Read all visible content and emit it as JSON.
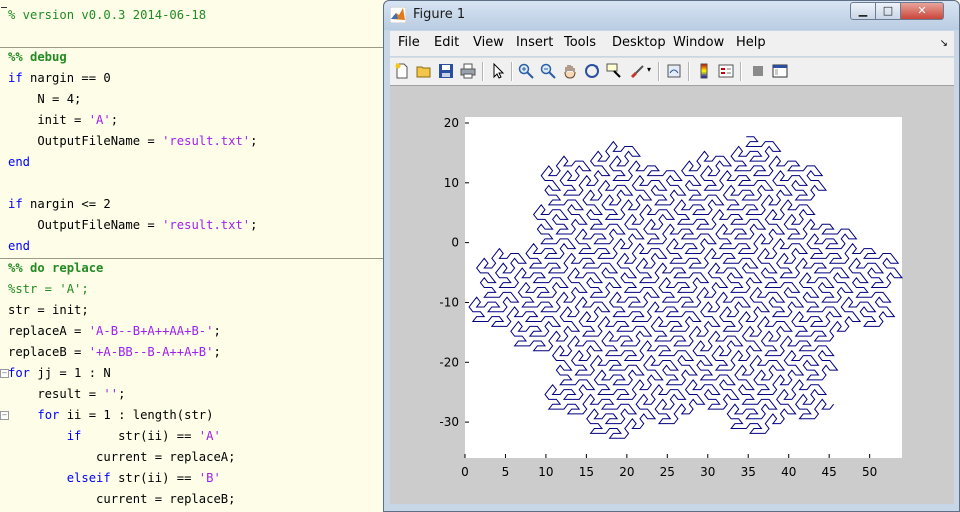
{
  "editor": {
    "lines": [
      {
        "segments": [
          {
            "t": "% version v0.0.3 2014-06-18",
            "c": "comment"
          }
        ]
      },
      {
        "segments": []
      },
      {
        "segments": [
          {
            "t": "%% debug",
            "c": "section"
          }
        ]
      },
      {
        "segments": [
          {
            "t": "if",
            "c": "kw"
          },
          {
            "t": " nargin == 0",
            "c": ""
          }
        ]
      },
      {
        "segments": [
          {
            "t": "    N = 4;",
            "c": ""
          }
        ]
      },
      {
        "segments": [
          {
            "t": "    init = ",
            "c": ""
          },
          {
            "t": "'A'",
            "c": "str"
          },
          {
            "t": ";",
            "c": ""
          }
        ]
      },
      {
        "segments": [
          {
            "t": "    OutputFileName = ",
            "c": ""
          },
          {
            "t": "'result.txt'",
            "c": "str"
          },
          {
            "t": ";",
            "c": ""
          }
        ]
      },
      {
        "segments": [
          {
            "t": "end",
            "c": "kw"
          }
        ]
      },
      {
        "segments": []
      },
      {
        "segments": [
          {
            "t": "if",
            "c": "kw"
          },
          {
            "t": " nargin <= 2",
            "c": ""
          }
        ]
      },
      {
        "segments": [
          {
            "t": "    OutputFileName = ",
            "c": ""
          },
          {
            "t": "'result.txt'",
            "c": "str"
          },
          {
            "t": ";",
            "c": ""
          }
        ]
      },
      {
        "segments": [
          {
            "t": "end",
            "c": "kw"
          }
        ]
      },
      {
        "segments": [
          {
            "t": "%% do replace",
            "c": "section"
          }
        ]
      },
      {
        "segments": [
          {
            "t": "%str = 'A';",
            "c": "comment"
          }
        ]
      },
      {
        "segments": [
          {
            "t": "str = init;",
            "c": ""
          }
        ]
      },
      {
        "segments": [
          {
            "t": "replaceA = ",
            "c": ""
          },
          {
            "t": "'A-B--B+A++AA+B-'",
            "c": "str"
          },
          {
            "t": ";",
            "c": ""
          }
        ]
      },
      {
        "segments": [
          {
            "t": "replaceB = ",
            "c": ""
          },
          {
            "t": "'+A-BB--B-A++A+B'",
            "c": "str"
          },
          {
            "t": ";",
            "c": ""
          }
        ]
      },
      {
        "segments": [
          {
            "t": "for",
            "c": "kw"
          },
          {
            "t": " jj = 1 : N",
            "c": ""
          }
        ]
      },
      {
        "segments": [
          {
            "t": "    result = ",
            "c": ""
          },
          {
            "t": "''",
            "c": "str"
          },
          {
            "t": ";",
            "c": ""
          }
        ]
      },
      {
        "segments": [
          {
            "t": "    ",
            "c": ""
          },
          {
            "t": "for",
            "c": "kw"
          },
          {
            "t": " ii = 1 : length(str)",
            "c": ""
          }
        ]
      },
      {
        "segments": [
          {
            "t": "        ",
            "c": ""
          },
          {
            "t": "if",
            "c": "kw"
          },
          {
            "t": "     str(ii) == ",
            "c": ""
          },
          {
            "t": "'A'",
            "c": "str"
          }
        ]
      },
      {
        "segments": [
          {
            "t": "            current = replaceA;",
            "c": ""
          }
        ]
      },
      {
        "segments": [
          {
            "t": "        ",
            "c": ""
          },
          {
            "t": "elseif",
            "c": "kw"
          },
          {
            "t": " str(ii) == ",
            "c": ""
          },
          {
            "t": "'B'",
            "c": "str"
          }
        ]
      },
      {
        "segments": [
          {
            "t": "            current = replaceB;",
            "c": ""
          }
        ]
      }
    ]
  },
  "figure": {
    "title": "Figure 1",
    "window_controls": {
      "minimize": "▁",
      "maximize": "□",
      "close": "✕"
    },
    "menu": [
      "File",
      "Edit",
      "View",
      "Insert",
      "Tools",
      "Desktop",
      "Window",
      "Help"
    ],
    "menu_overflow": "↘",
    "toolbar": [
      "new-figure",
      "open-file",
      "save",
      "print",
      "edit-plot",
      "zoom-in",
      "zoom-out",
      "pan",
      "rotate-3d",
      "data-cursor",
      "brush",
      "link-plot",
      "colorbar",
      "legend",
      "hide-plot-tools",
      "show-plot-tools"
    ]
  },
  "chart_data": {
    "type": "line",
    "title": "",
    "xlabel": "",
    "ylabel": "",
    "xlim": [
      0,
      54
    ],
    "ylim": [
      -36,
      21
    ],
    "xticks": [
      0,
      5,
      10,
      15,
      20,
      25,
      30,
      35,
      40,
      45,
      50
    ],
    "yticks": [
      20,
      10,
      0,
      -10,
      -20,
      -30
    ],
    "grid": false,
    "series": [
      {
        "line_color": "#000080",
        "generator": {
          "axiom": "A",
          "A": "A-B--B+A++AA+B-",
          "B": "+A-BB--B-A++A+B",
          "iterations": 4,
          "turn_degrees": 60
        }
      }
    ]
  }
}
